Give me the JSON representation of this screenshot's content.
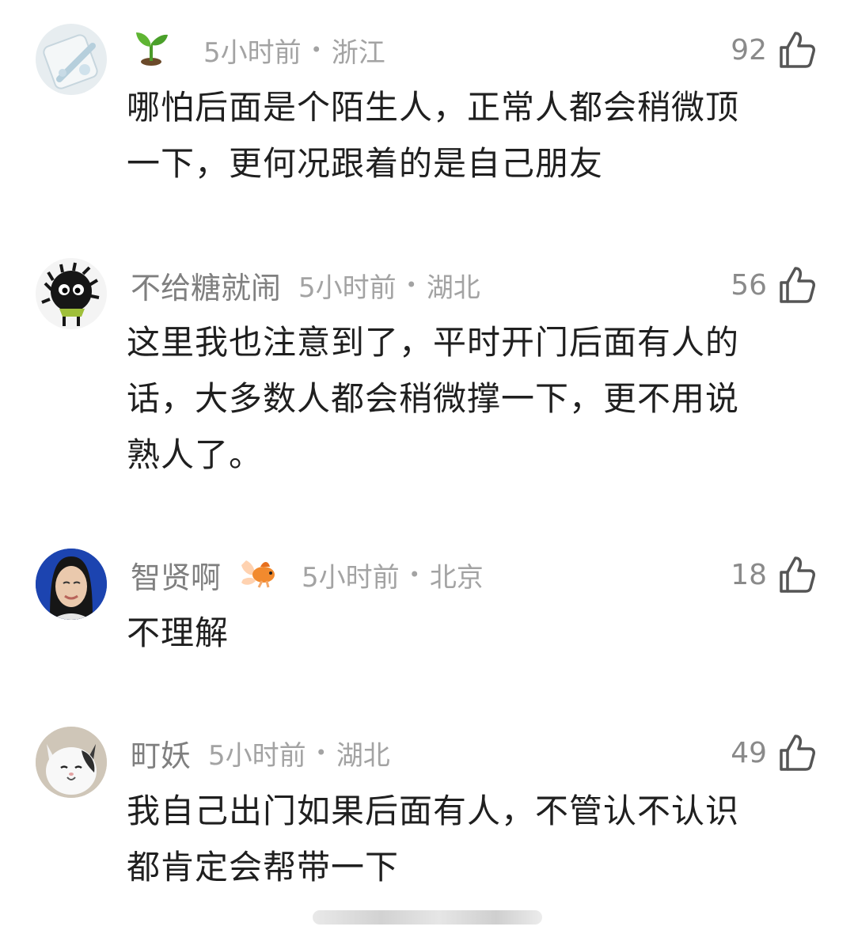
{
  "comments": [
    {
      "username": "",
      "badge": "sprout-emoji",
      "time": "5小时前",
      "location": "浙江",
      "likes": "92",
      "lines": [
        "哪怕后面是个陌生人，正常人都会稍微顶",
        "一下，更何况跟着的是自己朋友"
      ],
      "avatar_colors": [
        "#dfe8ec",
        "#bcd4e0"
      ]
    },
    {
      "username": "不给糖就闹",
      "time": "5小时前",
      "location": "湖北",
      "likes": "56",
      "lines": [
        "这里我也注意到了，平时开门后面有人的",
        "话，大多数人都会稍微撑一下，更不用说",
        "熟人了。"
      ],
      "avatar_colors": [
        "#f2f2f2",
        "#1a1a1a"
      ]
    },
    {
      "username": "智贤啊",
      "badge": "goldfish-emoji",
      "time": "5小时前",
      "location": "北京",
      "likes": "18",
      "lines": [
        "不理解"
      ],
      "avatar_colors": [
        "#1a3fa8",
        "#e8c3a8"
      ]
    },
    {
      "username": "町妖",
      "time": "5小时前",
      "location": "湖北",
      "likes": "49",
      "lines": [
        "我自己出门如果后面有人，不管认不认识",
        "都肯定会帮带一下"
      ],
      "avatar_colors": [
        "#d9d2c6",
        "#ffffff"
      ]
    }
  ],
  "separator": "•",
  "like_icon": "thumbs-up-icon"
}
